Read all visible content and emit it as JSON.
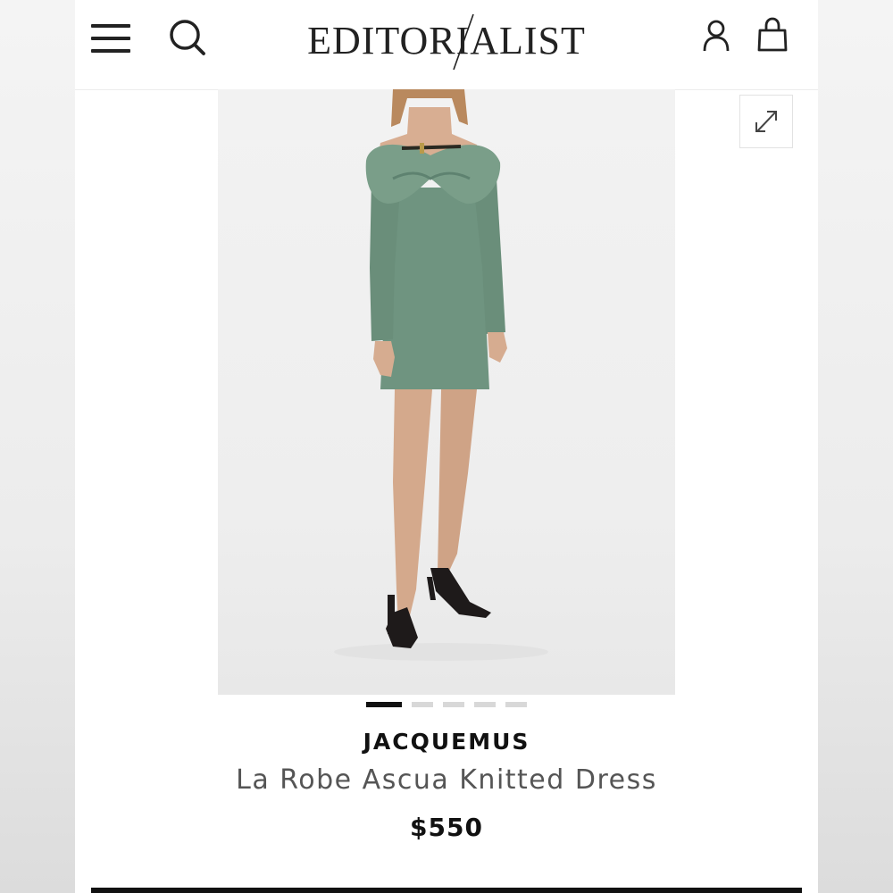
{
  "header": {
    "logo": "EDITORIALIST",
    "icons": {
      "menu": "menu-icon",
      "search": "search-icon",
      "account": "user-icon",
      "bag": "shopping-bag-icon"
    }
  },
  "gallery": {
    "expand_icon": "expand-icon",
    "total_images": 5,
    "active_index": 1
  },
  "product": {
    "brand": "JACQUEMUS",
    "name": "La Robe Ascua Knitted Dress",
    "price": "$550",
    "dress_color": "#6f9480"
  }
}
